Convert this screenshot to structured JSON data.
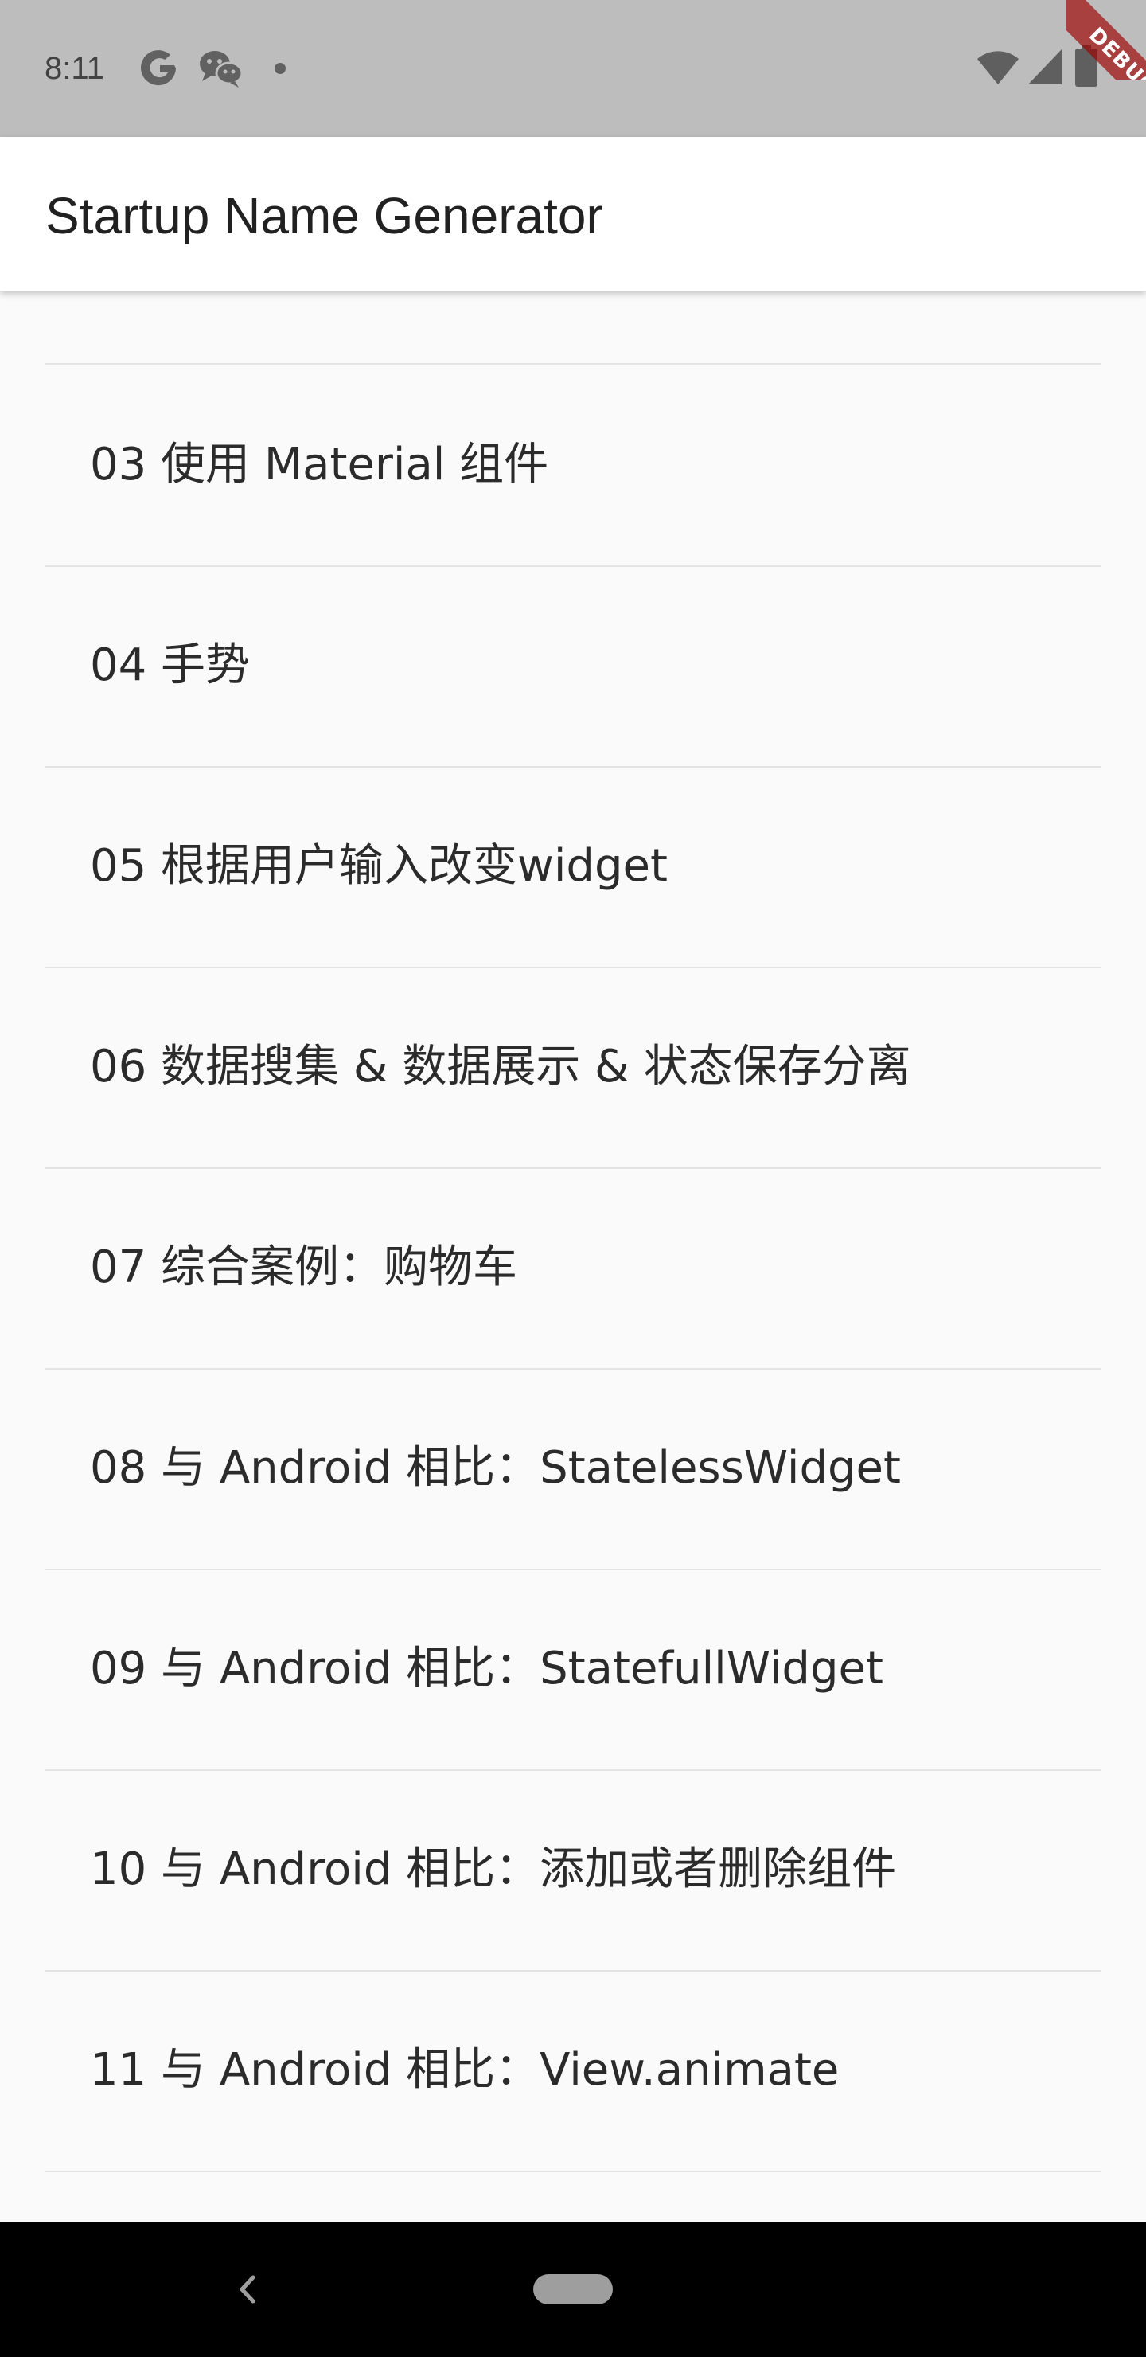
{
  "status_bar": {
    "time": "8:11",
    "icons": [
      "google-icon",
      "wechat-icon",
      "notification-dot-icon",
      "wifi-icon",
      "cellular-signal-icon",
      "battery-icon"
    ]
  },
  "debug_banner": "DEBUG",
  "app_bar": {
    "title": "Startup Name Generator"
  },
  "list": {
    "items": [
      {
        "label": "03 使用 Material 组件"
      },
      {
        "label": "04 手势"
      },
      {
        "label": "05 根据用户输入改变widget"
      },
      {
        "label": "06 数据搜集 & 数据展示 & 状态保存分离"
      },
      {
        "label": "07 综合案例：购物车"
      },
      {
        "label": "08 与 Android 相比：StatelessWidget"
      },
      {
        "label": "09 与 Android 相比：StatefullWidget"
      },
      {
        "label": "10 与 Android 相比：添加或者删除组件"
      },
      {
        "label": "11 与 Android 相比：View.animate"
      }
    ]
  },
  "nav_bar": {
    "buttons": [
      "back-icon",
      "home-pill-icon"
    ]
  },
  "colors": {
    "status_bar": "#bdbdbd",
    "app_bar": "#ffffff",
    "background": "#fafafa",
    "divider": "#e4e4e4",
    "debug_ribbon": "#a00000",
    "nav_bar": "#000000"
  }
}
